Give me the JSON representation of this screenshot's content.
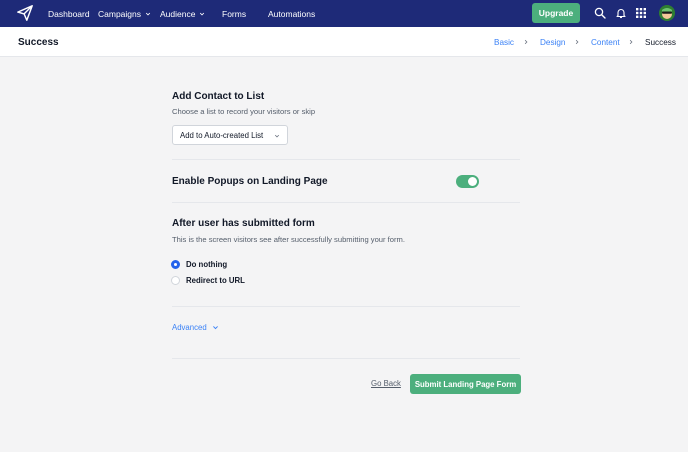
{
  "nav": {
    "items": [
      {
        "label": "Dashboard",
        "has_dropdown": false
      },
      {
        "label": "Campaigns",
        "has_dropdown": true
      },
      {
        "label": "Audience",
        "has_dropdown": true
      },
      {
        "label": "Forms",
        "has_dropdown": false
      },
      {
        "label": "Automations",
        "has_dropdown": false
      }
    ],
    "upgrade_label": "Upgrade",
    "icons": [
      "paper-plane-logo-icon",
      "search-icon",
      "bell-icon",
      "apps-grid-icon",
      "avatar"
    ]
  },
  "header": {
    "title": "Success",
    "breadcrumb": [
      {
        "label": "Basic",
        "state": "link"
      },
      {
        "label": "Design",
        "state": "link"
      },
      {
        "label": "Content",
        "state": "link"
      },
      {
        "label": "Success",
        "state": "current"
      }
    ]
  },
  "contact_list": {
    "title": "Add Contact to List",
    "subtitle": "Choose a list to record your visitors or skip",
    "selected": "Add to Auto-created List"
  },
  "popups": {
    "title": "Enable Popups on Landing Page",
    "enabled": true
  },
  "after_submit": {
    "title": "After user has submitted form",
    "subtitle": "This is the screen visitors see after successfully submitting your form.",
    "options": [
      {
        "label": "Do nothing",
        "selected": true
      },
      {
        "label": "Redirect to URL",
        "selected": false
      }
    ]
  },
  "advanced_label": "Advanced",
  "footer": {
    "back_label": "Go Back",
    "submit_label": "Submit Landing Page Form"
  },
  "colors": {
    "nav_bg": "#1e2a78",
    "accent_green": "#4caf7d",
    "link_blue": "#3b82f6",
    "radio_blue": "#2563eb"
  }
}
